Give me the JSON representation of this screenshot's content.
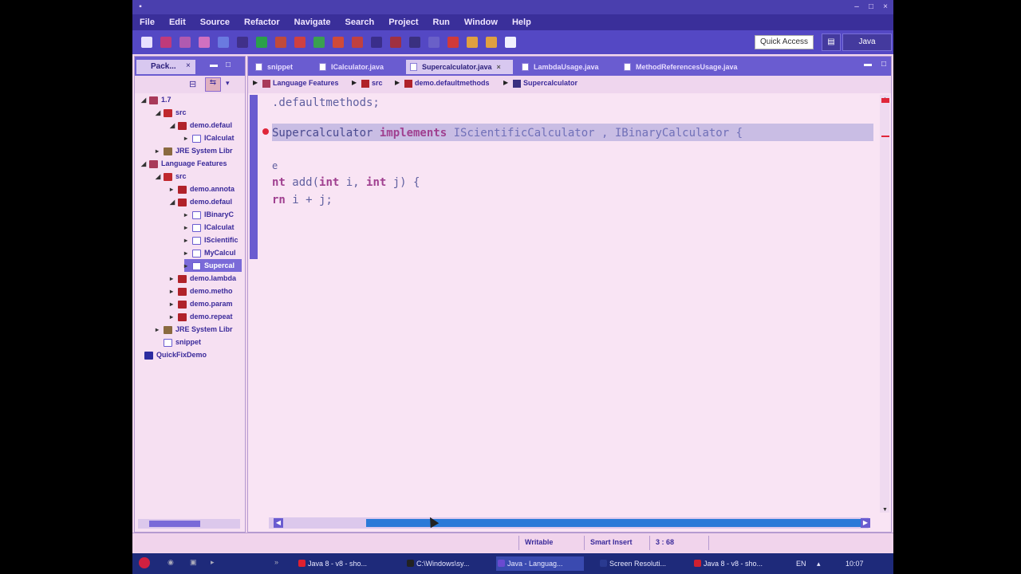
{
  "menu": [
    "File",
    "Edit",
    "Source",
    "Refactor",
    "Navigate",
    "Search",
    "Project",
    "Run",
    "Window",
    "Help"
  ],
  "toolbar": {
    "quick_access": "Quick Access",
    "perspective": "Java"
  },
  "explorer": {
    "tab_label": "Pack...",
    "items": [
      {
        "label": "1.7",
        "icon": "project-icon"
      },
      {
        "label": "src",
        "icon": "source-folder-icon"
      },
      {
        "label": "demo.defaul",
        "icon": "package-icon"
      },
      {
        "label": "ICalculat",
        "icon": "java-file-icon"
      },
      {
        "label": "JRE System Libr",
        "icon": "library-icon"
      },
      {
        "label": "Language Features",
        "icon": "project-icon"
      },
      {
        "label": "src",
        "icon": "source-folder-icon"
      },
      {
        "label": "demo.annota",
        "icon": "package-icon"
      },
      {
        "label": "demo.defaul",
        "icon": "package-icon"
      },
      {
        "label": "IBinaryC",
        "icon": "java-file-icon"
      },
      {
        "label": "ICalculat",
        "icon": "java-file-icon"
      },
      {
        "label": "IScientific",
        "icon": "java-file-icon"
      },
      {
        "label": "MyCalcul",
        "icon": "java-file-icon"
      },
      {
        "label": "Supercal",
        "icon": "java-file-icon"
      },
      {
        "label": "demo.lambda",
        "icon": "package-icon"
      },
      {
        "label": "demo.metho",
        "icon": "package-icon"
      },
      {
        "label": "demo.param",
        "icon": "package-icon"
      },
      {
        "label": "demo.repeat",
        "icon": "package-icon"
      },
      {
        "label": "JRE System Libr",
        "icon": "library-icon"
      },
      {
        "label": "snippet",
        "icon": "java-file-icon"
      },
      {
        "label": "QuickFixDemo",
        "icon": "book-icon"
      }
    ]
  },
  "editor": {
    "tabs": [
      {
        "label": "snippet"
      },
      {
        "label": "ICalculator.java"
      },
      {
        "label": "Supercalculator.java",
        "active": true
      },
      {
        "label": "LambdaUsage.java"
      },
      {
        "label": "MethodReferencesUsage.java"
      }
    ],
    "breadcrumb": [
      "Language Features",
      "src",
      "demo.defaultmethods",
      "Supercalculator"
    ],
    "code": {
      "line1": ".defaultmethods;",
      "line2_prefix": "Supercalculator ",
      "line2_kw": "implements",
      "line2_rest": " IScientificCalculator , IBinaryCalculator { ",
      "line3": "e",
      "line4_kw1": "nt",
      "line4_mid": " add(",
      "line4_kw2": "int",
      "line4_mid2": " i, ",
      "line4_kw3": "int",
      "line4_end": " j) {",
      "line5_kw": "rn",
      "line5_rest": " i + j;"
    }
  },
  "status": {
    "writable": "Writable",
    "insert_mode": "Smart Insert",
    "position": "3 : 68"
  },
  "taskbar": [
    {
      "label": "Java 8 - v8 - sho..."
    },
    {
      "label": "C:\\Windows\\sy..."
    },
    {
      "label": "Java - Languag...",
      "active": true
    },
    {
      "label": "Screen Resoluti..."
    },
    {
      "label": "Java 8 - v8 - sho..."
    }
  ],
  "tray": {
    "lang": "EN",
    "time": "10:07"
  }
}
